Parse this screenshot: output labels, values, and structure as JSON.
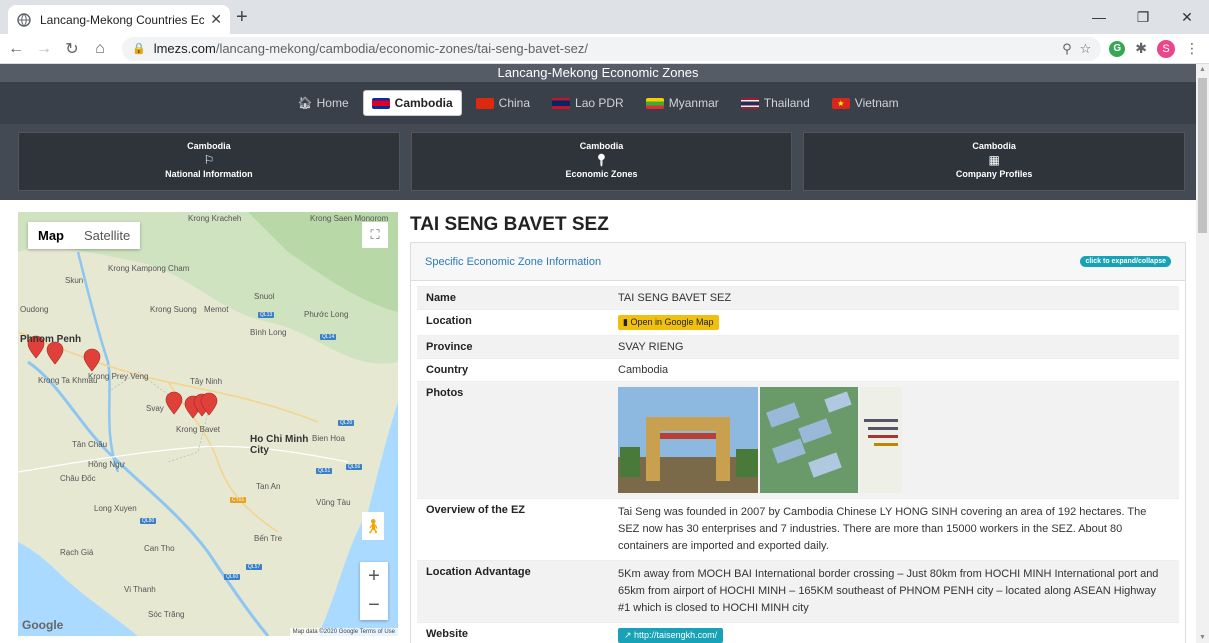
{
  "browser": {
    "tab_title": "Lancang-Mekong Countries Econ",
    "url_host": "lmezs.com",
    "url_path": "/lancang-mekong/cambodia/economic-zones/tai-seng-bavet-sez/",
    "avatar_letter": "S"
  },
  "site": {
    "title": "Lancang-Mekong Economic Zones",
    "nav": [
      {
        "label": "Home"
      },
      {
        "label": "Cambodia"
      },
      {
        "label": "China"
      },
      {
        "label": "Lao PDR"
      },
      {
        "label": "Myanmar"
      },
      {
        "label": "Thailand"
      },
      {
        "label": "Vietnam"
      }
    ],
    "cards": [
      {
        "top": "Cambodia",
        "bottom": "National Information"
      },
      {
        "top": "Cambodia",
        "bottom": "Economic Zones"
      },
      {
        "top": "Cambodia",
        "bottom": "Company Profiles"
      }
    ]
  },
  "map": {
    "type_map": "Map",
    "type_satellite": "Satellite",
    "attribution": "Map data ©2020 Google   Terms of Use",
    "google": "Google",
    "labels": {
      "kratie": "Krong Kracheh",
      "phnompenh": "Phnom Penh",
      "tayninh": "Tây Ninh",
      "hcmc": "Ho Chi Minh City",
      "bienhoa": "Bien Hoa",
      "longxuyen": "Long Xuyen",
      "cantho": "Can Tho",
      "bentre": "Bến Tre",
      "vungtau": "Vũng Tàu",
      "rachgia": "Rạch Giá",
      "soctrang": "Sóc Trăng",
      "tanchau": "Tân Châu",
      "chaudoc": "Châu Đốc",
      "hongngu": "Hồng Ngự",
      "binhlong": "Bình Long",
      "phuoclong": "Phước Long",
      "krongsaen": "Krong Saen Monorom",
      "kampong": "Krong Kampong Cham",
      "suong": "Krong Suong",
      "prey": "Krong Prey Veng",
      "khmau": "Krong Ta Khmau",
      "svay": "Svay",
      "bavet": "Krong Bavet",
      "tanan": "Tan An",
      "vithanh": "Vi Thanh",
      "oudong": "Oudong",
      "skun": "Skun",
      "memot": "Memot",
      "snuol": "Snuol"
    }
  },
  "zone": {
    "title": "TAI SENG BAVET SEZ",
    "panel_title": "Specific Economic Zone Information",
    "expand_badge": "click to expand/collapse",
    "rows": {
      "name_key": "Name",
      "name_val": "TAI SENG BAVET SEZ",
      "location_key": "Location",
      "location_btn": "Open in Google Map",
      "province_key": "Province",
      "province_val": "SVAY RIENG",
      "country_key": "Country",
      "country_val": "Cambodia",
      "photos_key": "Photos",
      "overview_key": "Overview of the EZ",
      "overview_val": "Tai Seng was founded in 2007 by Cambodia Chinese LY HONG SINH covering an area of 192 hectares. The SEZ now has 30 enterprises and 7 industries. There are more than 15000 workers in the SEZ. About 80 containers are imported and exported daily.",
      "advantage_key": "Location Advantage",
      "advantage_val": "5Km away from MOCH BAI International border crossing – Just 80km from HOCHI MINH International port and 65km from airport of HOCHI MINH – 165KM southeast of PHNOM PENH city – located along ASEAN Highway #1 which is closed to HOCHI MINH city",
      "website_key": "Website",
      "website_btn": "http://taisengkh.com/"
    }
  }
}
